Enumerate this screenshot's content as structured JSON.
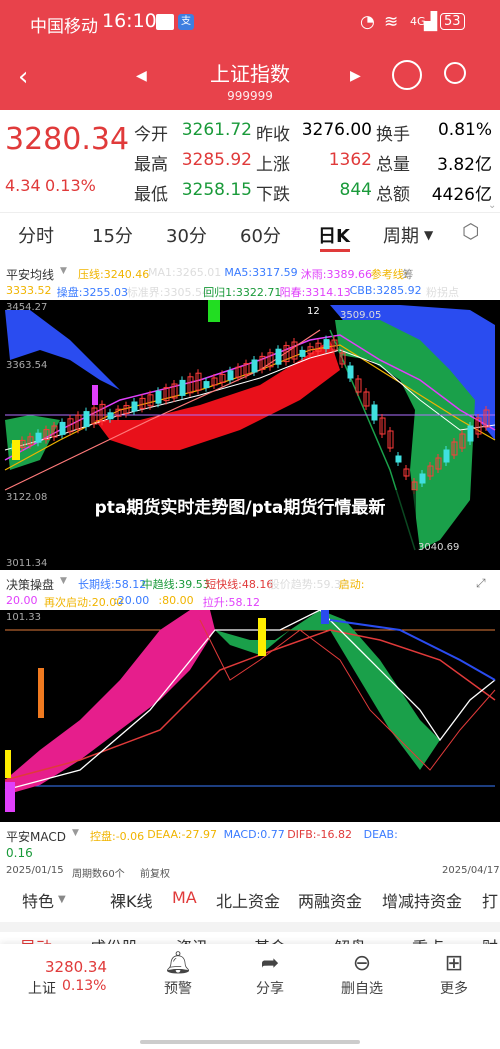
{
  "status": {
    "carrier": "中国移动",
    "time": "16:10",
    "signal": "4G",
    "battery": "53"
  },
  "header": {
    "title": "上证指数",
    "code": "999999"
  },
  "quote": {
    "price": "3280.34",
    "change": "4.34",
    "change_pct": "0.13%",
    "fields": [
      {
        "label": "今开",
        "value": "3261.72",
        "color": "green"
      },
      {
        "label": "昨收",
        "value": "3276.00",
        "color": "black"
      },
      {
        "label": "换手",
        "value": "0.81%",
        "color": "black"
      },
      {
        "label": "最高",
        "value": "3285.92",
        "color": "red"
      },
      {
        "label": "上涨",
        "value": "1362",
        "color": "red"
      },
      {
        "label": "总量",
        "value": "3.82亿",
        "color": "black"
      },
      {
        "label": "最低",
        "value": "3258.15",
        "color": "green"
      },
      {
        "label": "下跌",
        "value": "844",
        "color": "green"
      },
      {
        "label": "总额",
        "value": "4426亿",
        "color": "black"
      }
    ]
  },
  "periods": {
    "tabs": [
      "分时",
      "15分",
      "30分",
      "60分",
      "日K",
      "周期"
    ],
    "active": "日K"
  },
  "main_chart": {
    "indicator": "平安均线",
    "legend_row1": [
      {
        "text": "压线:3240.46",
        "color": "#f0b400"
      },
      {
        "text": "MA1:3265.01",
        "color": "#dddddd"
      },
      {
        "text": "MA5:3317.59",
        "color": "#3a7bff"
      },
      {
        "text": "沐雨:3389.66",
        "color": "#e040fb"
      },
      {
        "text": "参考线:",
        "color": "#f0b400"
      },
      {
        "text": "筹",
        "color": "#888888"
      }
    ],
    "legend_row2": [
      {
        "text": "3333.52",
        "color": "#f0b400"
      },
      {
        "text": "操盘:3255.03",
        "color": "#3a7bff"
      },
      {
        "text": "标准界:3305.54",
        "color": "#dddddd"
      },
      {
        "text": "回归1:3322.71",
        "color": "#1a9a3a"
      },
      {
        "text": "阳春:3314.13",
        "color": "#e040fb"
      },
      {
        "text": "CBB:3285.92",
        "color": "#3a7bff"
      },
      {
        "text": "粉拐点",
        "color": "#dddddd"
      }
    ],
    "axis": {
      "top": "3454.27",
      "mid_hi": "3363.54",
      "low": "3122.08",
      "bottom": "3011.34"
    },
    "annotations": {
      "hi": "3509.05",
      "hi_prefix": "12",
      "lo": "3040.69"
    },
    "overlay": "pta期货实时走势图/pta期货行情最新"
  },
  "sub_chart": {
    "indicator": "决策操盘",
    "legend_row1": [
      {
        "text": "长期线:58.12",
        "color": "#3a7bff"
      },
      {
        "text": "中趋线:39.53",
        "color": "#1a9a3a"
      },
      {
        "text": "短快线:48.16",
        "color": "#e03a3a"
      },
      {
        "text": "股价趋势:59.37",
        "color": "#dddddd"
      },
      {
        "text": "启动:",
        "color": "#f0b400"
      }
    ],
    "legend_row2": [
      {
        "text": "20.00",
        "color": "#e040fb"
      },
      {
        "text": "再次启动:20.00",
        "color": "#f0b400"
      },
      {
        "text": ":20.00",
        "color": "#3a7bff"
      },
      {
        "text": ":80.00",
        "color": "#f0b400"
      },
      {
        "text": "拉升:58.12",
        "color": "#e040fb"
      }
    ],
    "axis": {
      "top": "101.33"
    }
  },
  "macd": {
    "indicator": "平安MACD",
    "legend": [
      {
        "text": "控盘:-0.06",
        "color": "#f0b400"
      },
      {
        "text": "DEAA:-27.97",
        "color": "#f0b400"
      },
      {
        "text": "MACD:0.77",
        "color": "#3a7bff"
      },
      {
        "text": "DIFB:-16.82",
        "color": "#e03a3a"
      },
      {
        "text": "DEAB:",
        "color": "#3a7bff"
      }
    ],
    "legend2": "0.16"
  },
  "date_bar": {
    "start": "2025/01/15",
    "period_count": "周期数60个",
    "adjust": "前复权",
    "end": "2025/04/17"
  },
  "feature_tabs": {
    "items": [
      "特色",
      "裸K线",
      "MA",
      "北上资金",
      "两融资金",
      "增减持资金",
      "打"
    ],
    "active": "MA"
  },
  "partial_tabs": [
    "异动",
    "成份股",
    "资讯",
    "基金",
    "解盘",
    "重点",
    "财"
  ],
  "bottom_nav": {
    "price": "3280.34",
    "label": "上证",
    "pct": "0.13%",
    "items": [
      "预警",
      "分享",
      "删自选",
      "更多"
    ]
  }
}
